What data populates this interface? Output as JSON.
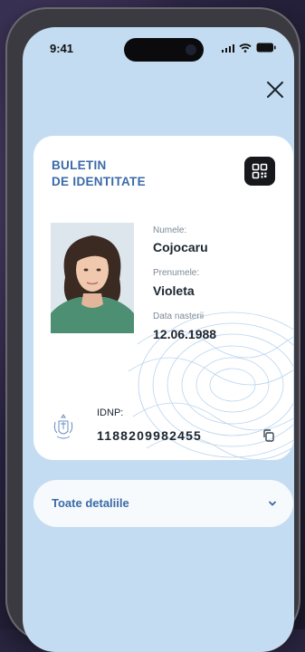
{
  "status_bar": {
    "time": "9:41"
  },
  "card": {
    "title_line1": "BULETIN",
    "title_line2": "DE IDENTITATE",
    "surname_label": "Numele:",
    "surname": "Cojocaru",
    "given_name_label": "Prenumele:",
    "given_name": "Violeta",
    "birth_date_label": "Data nasterii",
    "birth_date": "12.06.1988",
    "idnp_label": "IDNP:",
    "idnp": "1188209982455"
  },
  "details": {
    "label": "Toate detaliile"
  },
  "icons": {
    "close": "close-icon",
    "qr": "qr-code-icon",
    "copy": "copy-icon",
    "chevron": "chevron-down-icon",
    "coat_of_arms": "coat-of-arms-icon"
  },
  "colors": {
    "screen_bg": "#c4dcf1",
    "accent": "#3a6aa8",
    "card_bg": "#ffffff"
  }
}
